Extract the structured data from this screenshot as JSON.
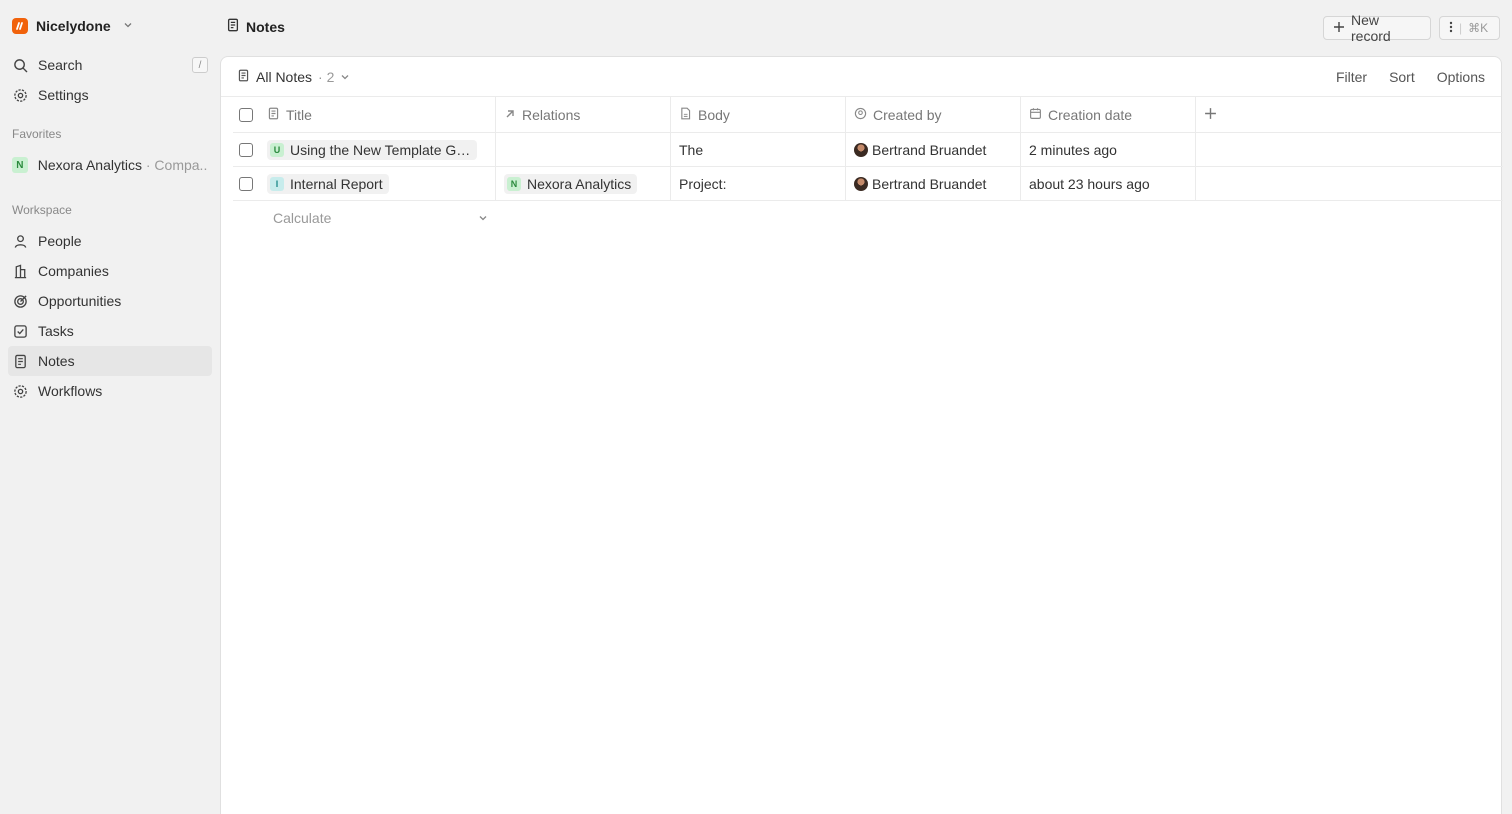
{
  "workspace": {
    "name": "Nicelydone"
  },
  "sidebar": {
    "search_label": "Search",
    "search_shortcut": "/",
    "settings_label": "Settings",
    "favorites_heading": "Favorites",
    "favorite": {
      "badge": "N",
      "name": "Nexora Analytics",
      "sub": "· Compa..."
    },
    "workspace_heading": "Workspace",
    "items": [
      {
        "label": "People",
        "icon": "person-icon"
      },
      {
        "label": "Companies",
        "icon": "building-icon"
      },
      {
        "label": "Opportunities",
        "icon": "target-icon"
      },
      {
        "label": "Tasks",
        "icon": "checkbox-icon"
      },
      {
        "label": "Notes",
        "icon": "notes-icon",
        "active": true
      },
      {
        "label": "Workflows",
        "icon": "gear-icon"
      }
    ]
  },
  "header": {
    "title": "Notes",
    "new_record_label": "New record",
    "shortcut_label": "⌘K"
  },
  "view": {
    "name": "All Notes",
    "count": "· 2",
    "filter_label": "Filter",
    "sort_label": "Sort",
    "options_label": "Options"
  },
  "table": {
    "columns": [
      "Title",
      "Relations",
      "Body",
      "Created by",
      "Creation date"
    ],
    "rows": [
      {
        "badge": "U",
        "title": "Using the New Template Ga...",
        "relation": "",
        "body": "The",
        "created_by": "Bertrand Bruandet",
        "date": "2 minutes ago"
      },
      {
        "badge": "I",
        "title": "Internal Report",
        "relation_badge": "N",
        "relation": "Nexora Analytics",
        "body": "Project:",
        "created_by": "Bertrand Bruandet",
        "date": "about 23 hours ago"
      }
    ],
    "calculate_label": "Calculate"
  }
}
